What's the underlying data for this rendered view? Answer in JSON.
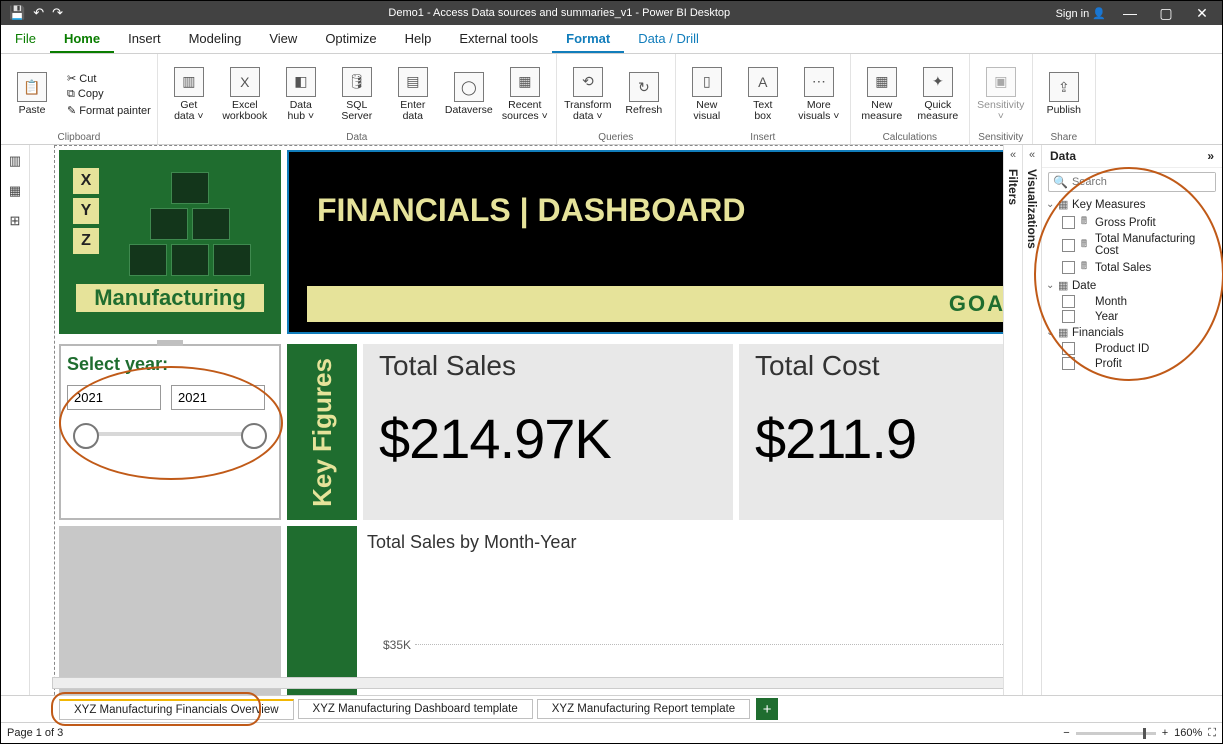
{
  "window": {
    "title": "Demo1 - Access Data sources and summaries_v1 - Power BI Desktop",
    "signin": "Sign in"
  },
  "maintabs": {
    "file": "File",
    "home": "Home",
    "insert": "Insert",
    "modeling": "Modeling",
    "view": "View",
    "optimize": "Optimize",
    "help": "Help",
    "external": "External tools",
    "format": "Format",
    "datadrill": "Data / Drill"
  },
  "ribbon": {
    "clipboard": {
      "label": "Clipboard",
      "paste": "Paste",
      "cut": "Cut",
      "copy": "Copy",
      "painter": "Format painter"
    },
    "data": {
      "label": "Data",
      "get": "Get\ndata ˅",
      "excel": "Excel\nworkbook",
      "hub": "Data\nhub ˅",
      "sql": "SQL\nServer",
      "enter": "Enter\ndata",
      "dataverse": "Dataverse",
      "recent": "Recent\nsources ˅"
    },
    "queries": {
      "label": "Queries",
      "transform": "Transform\ndata ˅",
      "refresh": "Refresh"
    },
    "insert": {
      "label": "Insert",
      "newv": "New\nvisual",
      "text": "Text\nbox",
      "more": "More\nvisuals ˅"
    },
    "calc": {
      "label": "Calculations",
      "newm": "New\nmeasure",
      "quick": "Quick\nmeasure"
    },
    "sens": {
      "label": "Sensitivity",
      "btn": "Sensitivity\n˅"
    },
    "share": {
      "label": "Share",
      "publish": "Publish"
    }
  },
  "panes": {
    "filters": "Filters",
    "viz": "Visualizations",
    "data": "Data",
    "search_ph": "Search"
  },
  "fields": {
    "t1": {
      "name": "Key Measures",
      "f1": "Gross Profit",
      "f2": "Total Manufacturing Cost",
      "f3": "Total Sales"
    },
    "t2": {
      "name": "Date",
      "f1": "Month",
      "f2": "Year"
    },
    "t3": {
      "name": "Financials",
      "f1": "Product ID",
      "f2": "Profit"
    }
  },
  "dash": {
    "manuf": "Manufacturing",
    "title": "FINANCIALS | DASHBOARD",
    "goals": "GOA",
    "slicer": {
      "title": "Select year:",
      "from": "2021",
      "to": "2021"
    },
    "kf": "Key Figures",
    "card1": {
      "cap": "Total Sales",
      "val": "$214.97K"
    },
    "card2": {
      "cap": "Total Cost",
      "val": "$211.9"
    },
    "chart": {
      "title": "Total Sales by Month-Year",
      "ylab": "$35K"
    }
  },
  "pages": {
    "p1": "XYZ Manufacturing Financials Overview",
    "p2": "XYZ Manufacturing Dashboard template",
    "p3": "XYZ Manufacturing Report template"
  },
  "status": {
    "page": "Page 1 of 3",
    "zoom": "160%"
  }
}
